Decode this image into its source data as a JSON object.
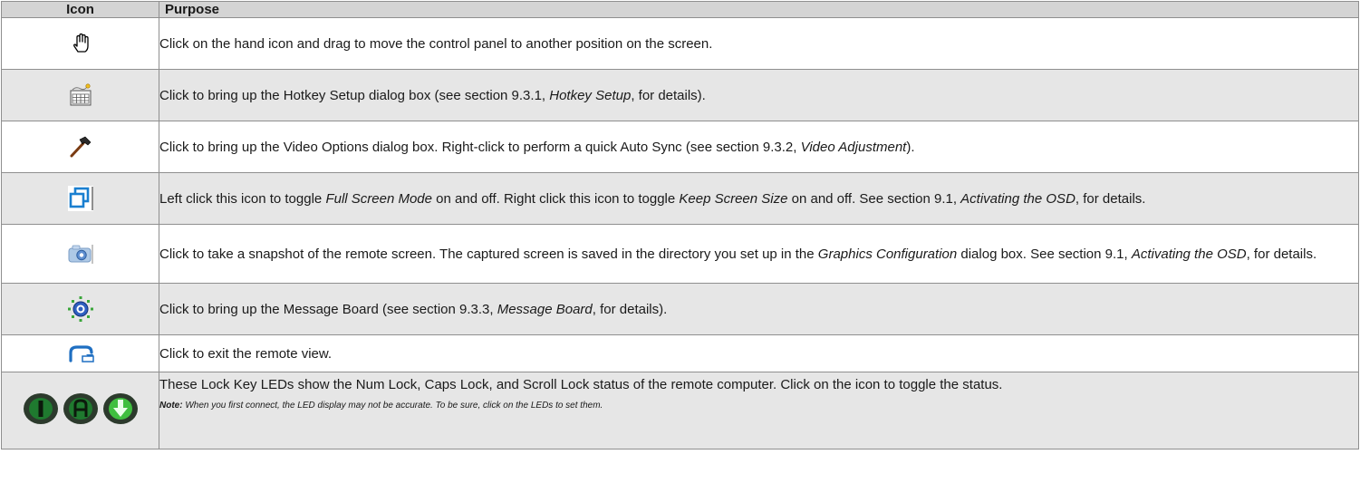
{
  "table": {
    "headers": {
      "icon": "Icon",
      "purpose": "Purpose"
    },
    "rows": [
      {
        "icon": "hand-icon",
        "parts": [
          "Click on the hand icon and drag to move the control panel to another position on the screen."
        ]
      },
      {
        "icon": "hotkey-keyboard-icon",
        "parts": [
          "Click to bring up the Hotkey Setup dialog box (see section 9.3.1, ",
          "Hotkey Setup",
          ", for details)."
        ]
      },
      {
        "icon": "hammer-icon",
        "parts": [
          "Click to bring up the Video Options dialog box. Right-click to perform a quick Auto Sync (see section 9.3.2, ",
          "Video Adjustment",
          ")."
        ]
      },
      {
        "icon": "full-screen-toggle-icon",
        "parts": [
          "Left click this icon to toggle ",
          "Full Screen Mode",
          " on and off. Right click this icon to toggle ",
          "Keep Screen Size",
          " on and off. See section 9.1, ",
          "Activating the OSD",
          ", for details."
        ]
      },
      {
        "icon": "snapshot-camera-icon",
        "parts": [
          "Click to take a snapshot of the remote screen. The captured screen is saved in the directory you set up in the ",
          "Graphics Configuration",
          " dialog box. See section 9.1, ",
          "Activating the OSD",
          ", for details."
        ]
      },
      {
        "icon": "message-board-icon",
        "parts": [
          "Click to bring up the Message Board (see section 9.3.3, ",
          "Message Board",
          ", for details)."
        ]
      },
      {
        "icon": "exit-arrow-icon",
        "parts": [
          "Click to exit the remote view."
        ]
      },
      {
        "icon": "lock-key-leds-icon",
        "parts": [
          "These Lock Key LEDs show the Num Lock, Caps Lock, and Scroll Lock status of the remote computer. Click on the icon to toggle the status."
        ],
        "note_label": "Note:",
        "note_text": " When you first connect, the LED display may not be accurate. To be sure, click on the LEDs to set them."
      }
    ]
  }
}
